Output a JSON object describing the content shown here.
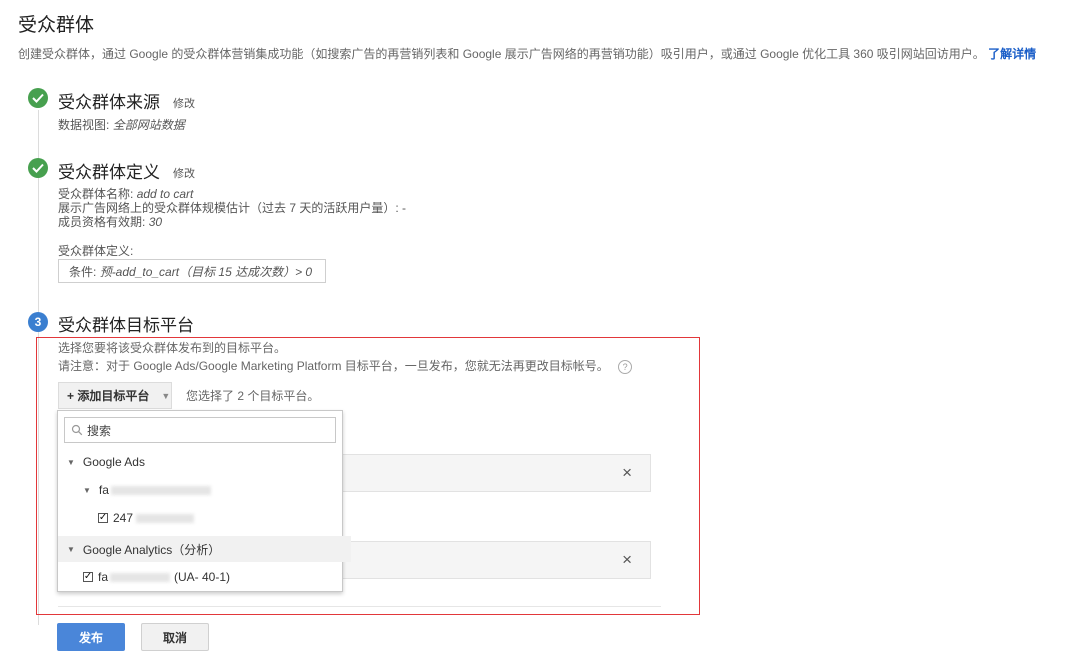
{
  "page": {
    "title": "受众群体",
    "description": "创建受众群体，通过 Google 的受众群体营销集成功能（如搜索广告的再营销列表和 Google 展示广告网络的再营销功能）吸引用户，或通过 Google 优化工具 360 吸引网站回访用户。",
    "learn_more": "了解详情"
  },
  "step1": {
    "title": "受众群体来源",
    "edit": "修改",
    "view_label": "数据视图:",
    "view_value": "全部网站数据"
  },
  "step2": {
    "title": "受众群体定义",
    "edit": "修改",
    "name_label": "受众群体名称:",
    "name_value": "add to cart",
    "size_label": "展示广告网络上的受众群体规模估计（过去 7 天的活跃用户量）:",
    "size_value": "-",
    "validity_label": "成员资格有效期:",
    "validity_value": "30",
    "definition_label": "受众群体定义:",
    "condition_prefix": "条件:",
    "condition_value": "预-add_to_cart（目标 15 达成次数）> 0"
  },
  "step3": {
    "number": "3",
    "title": "受众群体目标平台",
    "hint": "选择您要将该受众群体发布到的目标平台。",
    "note": "请注意：对于 Google Ads/Google Marketing Platform 目标平台，一旦发布，您就无法再更改目标帐号。",
    "help": "?",
    "add_button": "+ 添加目标平台",
    "selected_text": "您选择了 2 个目标平台。",
    "remove_symbol": "×"
  },
  "dropdown": {
    "search_placeholder": "搜索",
    "group1": "Google Ads",
    "group1_sub": "fa",
    "group1_item": "247",
    "group2": "Google Analytics（分析）",
    "group2_item_prefix": "fa",
    "group2_item_suffix": "(UA-                40-1)"
  },
  "actions": {
    "publish": "发布",
    "cancel": "取消"
  },
  "colors": {
    "accent": "#4a86d9",
    "check_green": "#47a04f",
    "highlight_border": "#e2373a",
    "link": "#1a5ec8"
  }
}
